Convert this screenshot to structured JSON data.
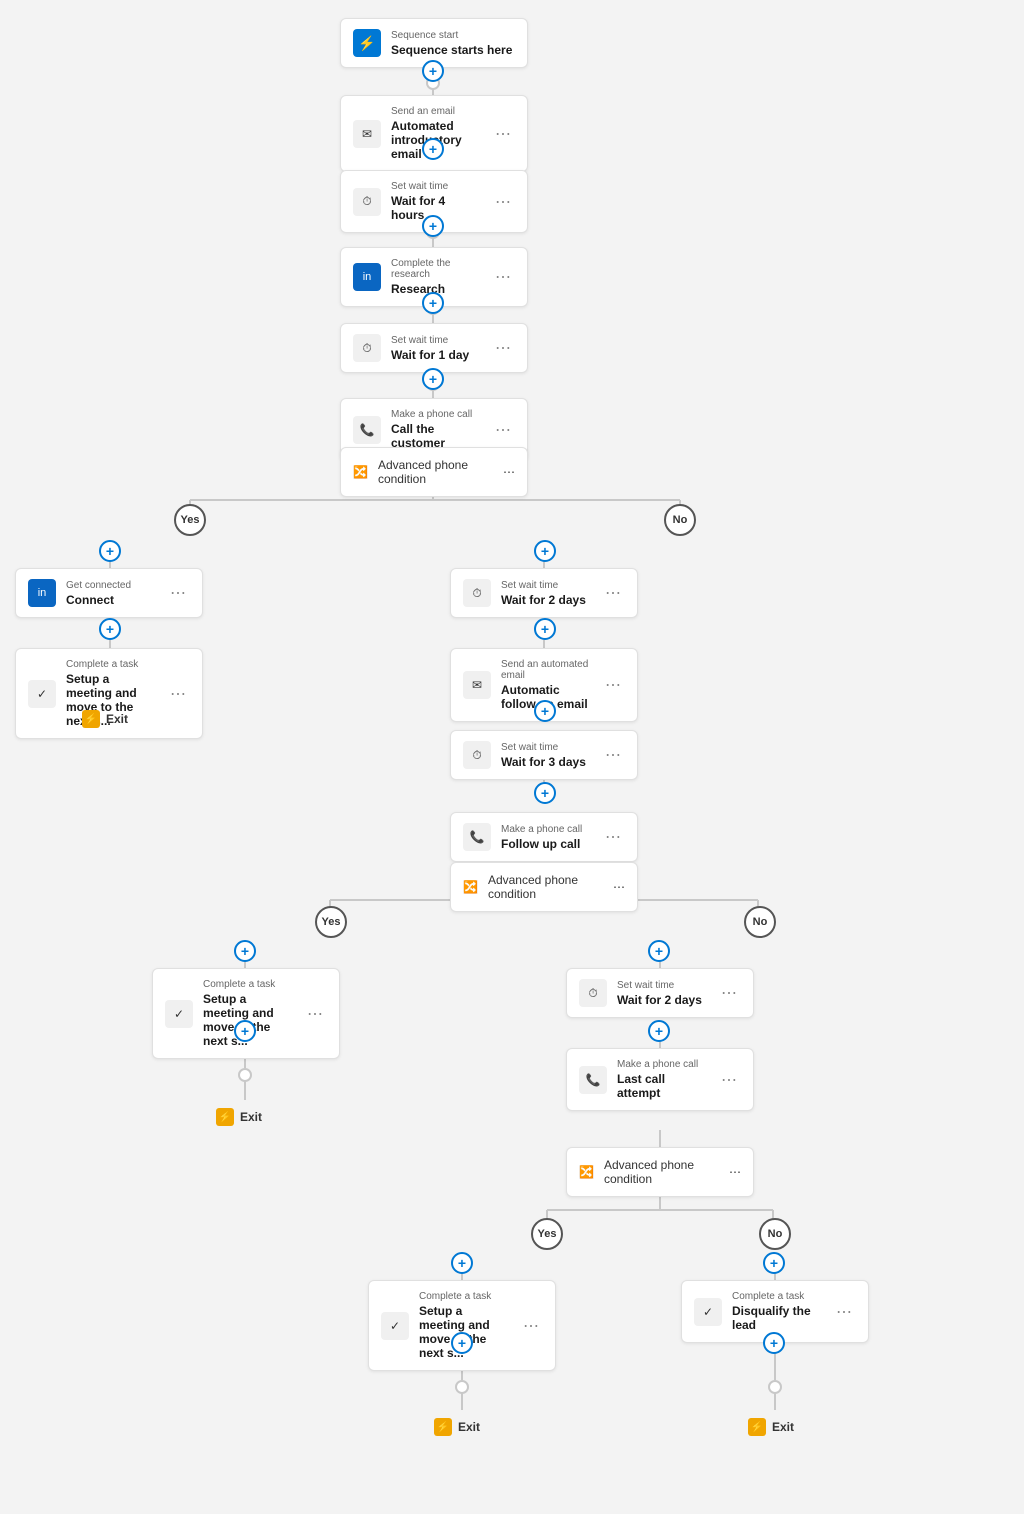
{
  "nodes": {
    "sequence_start": {
      "label": "Sequence start",
      "title": "Sequence starts here"
    },
    "send_email_1": {
      "label": "Send an email",
      "title": "Automated introductory email"
    },
    "wait_4h": {
      "label": "Set wait time",
      "title": "Wait for 4 hours"
    },
    "research": {
      "label": "Complete the research",
      "title": "Research"
    },
    "wait_1d": {
      "label": "Set wait time",
      "title": "Wait for 1 day"
    },
    "call_customer": {
      "label": "Make a phone call",
      "title": "Call the customer"
    },
    "condition_1": {
      "label": "",
      "title": "Advanced phone condition"
    },
    "connect": {
      "label": "Get connected",
      "title": "Connect"
    },
    "setup_meeting_1": {
      "label": "Complete a task",
      "title": "Setup a meeting and move to the next s..."
    },
    "exit_1": {
      "label": "",
      "title": "Exit"
    },
    "wait_2d_1": {
      "label": "Set wait time",
      "title": "Wait for 2 days"
    },
    "auto_followup": {
      "label": "Send an automated email",
      "title": "Automatic follow up email"
    },
    "wait_3d": {
      "label": "Set wait time",
      "title": "Wait for 3 days"
    },
    "followup_call": {
      "label": "Make a phone call",
      "title": "Follow up call"
    },
    "condition_2": {
      "label": "",
      "title": "Advanced phone condition"
    },
    "setup_meeting_2": {
      "label": "Complete a task",
      "title": "Setup a meeting and move to the next s..."
    },
    "exit_2": {
      "label": "",
      "title": "Exit"
    },
    "wait_2d_2": {
      "label": "Set wait time",
      "title": "Wait for 2 days"
    },
    "last_call": {
      "label": "Make a phone call",
      "title": "Last call attempt"
    },
    "condition_3": {
      "label": "",
      "title": "Advanced phone condition"
    },
    "setup_meeting_3": {
      "label": "Complete a task",
      "title": "Setup a meeting and move to the next s..."
    },
    "disqualify": {
      "label": "Complete a task",
      "title": "Disqualify the lead"
    },
    "exit_3": {
      "label": "",
      "title": "Exit"
    },
    "exit_4": {
      "label": "",
      "title": "Exit"
    }
  },
  "branches": {
    "yes": "Yes",
    "no": "No"
  },
  "colors": {
    "blue": "#0078d4",
    "connector": "#c8c8c8",
    "card_border": "#e0e0e0",
    "exit_icon": "#f0a500"
  }
}
